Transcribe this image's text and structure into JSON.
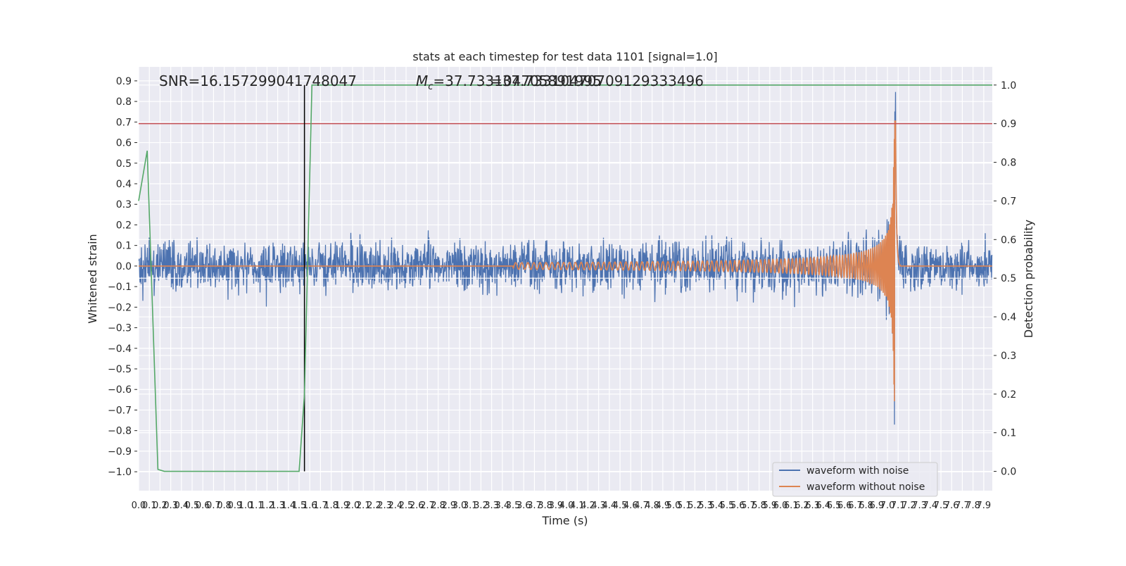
{
  "chart_data": {
    "type": "line",
    "title": "stats at each timestep for test data 1101 [signal=1.0]",
    "annotations": {
      "snr": "SNR=16.157299041748047",
      "mc_prefix": "M",
      "mc_sub": "c",
      "mc_value_a": "=37.733104705891995",
      "mc_value_b": "=37.73310470709129333496"
    },
    "xlabel": "Time (s)",
    "ylabel_left": "Whitened strain",
    "ylabel_right": "Detection probability",
    "xlim": [
      0.0,
      7.98
    ],
    "ylim_left": [
      -1.092,
      0.968
    ],
    "ylim_right": [
      -0.05,
      1.047
    ],
    "x_ticks": [
      0.0,
      0.1,
      0.2,
      0.3,
      0.4,
      0.5,
      0.6,
      0.7,
      0.8,
      0.9,
      1.0,
      1.1,
      1.2,
      1.3,
      1.4,
      1.5,
      1.6,
      1.7,
      1.8,
      1.9,
      2.0,
      2.1,
      2.2,
      2.3,
      2.4,
      2.5,
      2.6,
      2.7,
      2.8,
      2.9,
      3.0,
      3.1,
      3.2,
      3.3,
      3.4,
      3.5,
      3.6,
      3.7,
      3.8,
      3.9,
      4.0,
      4.1,
      4.2,
      4.3,
      4.4,
      4.5,
      4.6,
      4.7,
      4.8,
      4.9,
      5.0,
      5.1,
      5.2,
      5.3,
      5.4,
      5.5,
      5.6,
      5.7,
      5.8,
      5.9,
      6.0,
      6.1,
      6.2,
      6.3,
      6.4,
      6.5,
      6.6,
      6.7,
      6.8,
      6.9,
      7.0,
      7.1,
      7.2,
      7.3,
      7.4,
      7.5,
      7.6,
      7.7,
      7.8,
      7.9
    ],
    "y_ticks_left": [
      0.9,
      0.8,
      0.7,
      0.6,
      0.5,
      0.4,
      0.3,
      0.2,
      0.1,
      0.0,
      -0.1,
      -0.2,
      -0.3,
      -0.4,
      -0.5,
      -0.6,
      -0.7,
      -0.8,
      -0.9,
      -1.0
    ],
    "y_ticks_right": [
      1.0,
      0.9,
      0.8,
      0.7,
      0.6,
      0.5,
      0.4,
      0.3,
      0.2,
      0.1,
      0.0
    ],
    "grid": true,
    "legend_position": "lower-right",
    "series": [
      {
        "name": "waveform with noise",
        "color": "#4c72b0",
        "axis": "left",
        "noise_peak_range": [
          -0.96,
          0.88
        ]
      },
      {
        "name": "waveform without noise",
        "color": "#dd8452",
        "axis": "left",
        "merger_time": 7.07,
        "peak": 0.73,
        "trough": -0.75,
        "chirp_start": 3.8
      },
      {
        "color": "#55a868",
        "axis": "right",
        "x": [
          0.0,
          0.08,
          0.18,
          0.24,
          1.5,
          1.55,
          1.62,
          7.98
        ],
        "y": [
          0.7,
          0.83,
          0.005,
          0.0,
          0.0,
          0.2,
          1.0,
          1.0
        ]
      }
    ],
    "threshold": {
      "value": 0.9,
      "axis": "right",
      "color": "#c44e52"
    },
    "vertical_marker": {
      "x": 1.55,
      "y_range": [
        0.0,
        1.0
      ],
      "axis": "right",
      "color": "#000000"
    }
  }
}
